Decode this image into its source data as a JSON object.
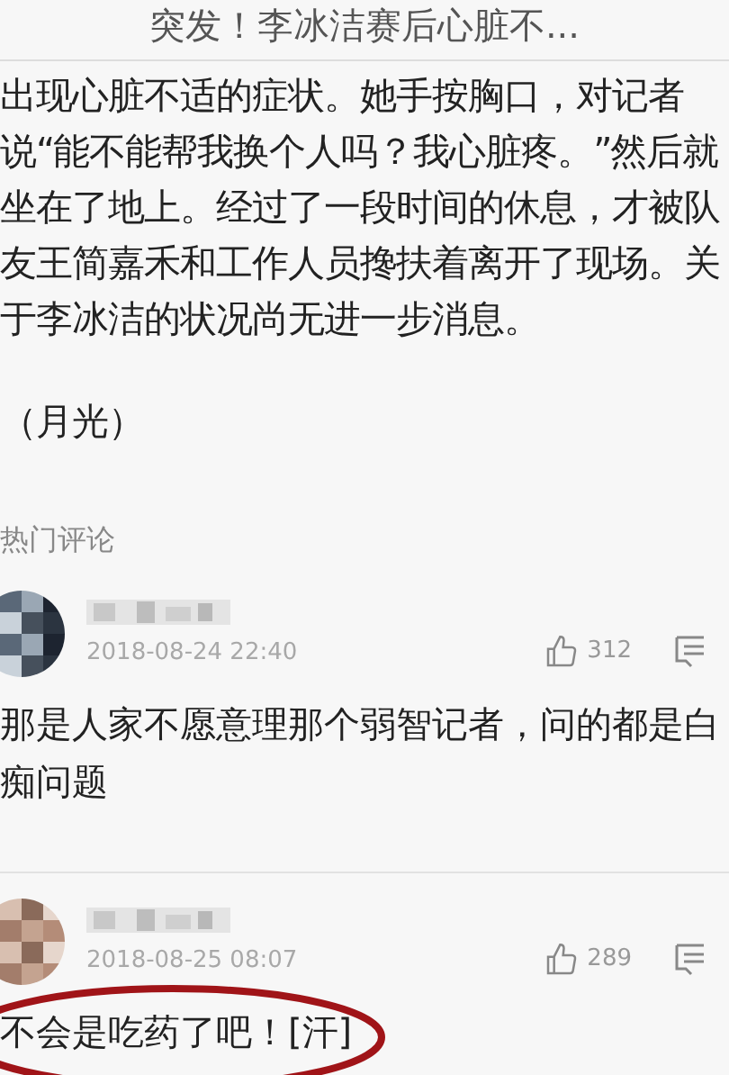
{
  "header": {
    "title": "突发！李冰洁赛后心脏不..."
  },
  "article": {
    "paragraphs": [
      "出现心脏不适的症状。她手按胸口，对记者说“能不能帮我换个人吗？我心脏疼。”然后就坐在了地上。经过了一段时间的休息，才被队友王简嘉禾和工作人员搀扶着离开了现场。关于李冰洁的状况尚无进一步消息。",
      "（月光）"
    ]
  },
  "comments_section": {
    "heading": "热门评论",
    "comments": [
      {
        "date": "2018-08-24 22:40",
        "likes": "312",
        "text": "那是人家不愿意理那个弱智记者，问的都是白痴问题",
        "circled": false
      },
      {
        "date": "2018-08-25 08:07",
        "likes": "289",
        "text": "不会是吃药了吧！[汗]",
        "circled": true
      }
    ]
  }
}
